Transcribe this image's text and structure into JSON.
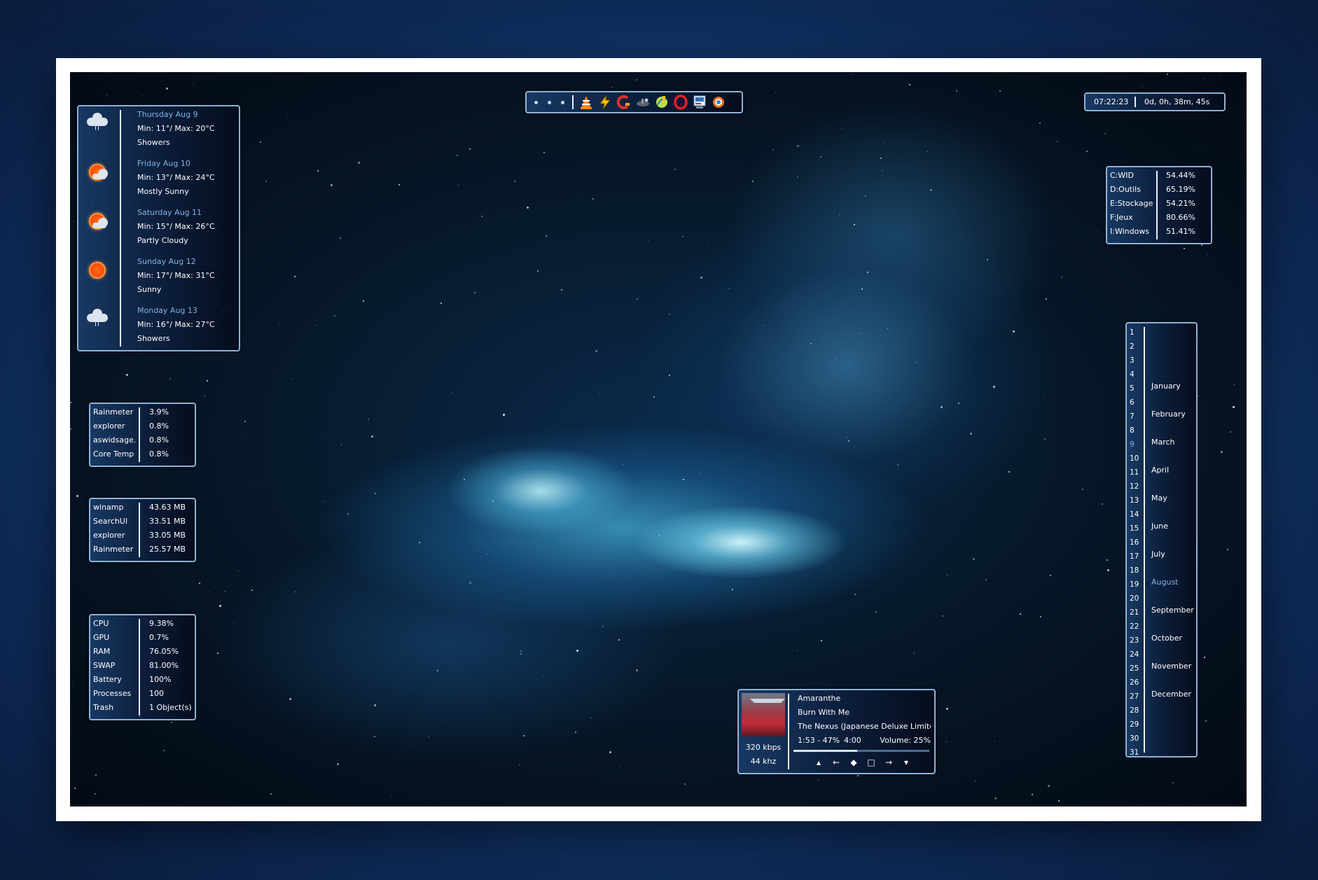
{
  "clock": {
    "time": "07:22:23",
    "uptime": "0d, 0h, 38m, 45s"
  },
  "weather": [
    {
      "day": "Thursday Aug 9",
      "temps": "Min: 11°/ Max: 20°C",
      "cond": "Showers",
      "icon": "showers-icon"
    },
    {
      "day": "Friday Aug 10",
      "temps": "Min: 13°/ Max: 24°C",
      "cond": "Mostly Sunny",
      "icon": "mostly-sunny-icon"
    },
    {
      "day": "Saturday Aug 11",
      "temps": "Min: 15°/ Max: 26°C",
      "cond": "Partly Cloudy",
      "icon": "partly-cloudy-icon"
    },
    {
      "day": "Sunday Aug 12",
      "temps": "Min: 17°/ Max: 31°C",
      "cond": "Sunny",
      "icon": "sunny-icon"
    },
    {
      "day": "Monday Aug 13",
      "temps": "Min: 16°/ Max: 27°C",
      "cond": "Showers",
      "icon": "showers-icon"
    }
  ],
  "cpu_procs": [
    {
      "name": "Rainmeter",
      "value": "3.9%"
    },
    {
      "name": "explorer",
      "value": "0.8%"
    },
    {
      "name": "aswidsage...",
      "value": "0.8%"
    },
    {
      "name": "Core Temp",
      "value": "0.8%"
    }
  ],
  "mem_procs": [
    {
      "name": "winamp",
      "value": "43.63 MB"
    },
    {
      "name": "SearchUI",
      "value": "33.51 MB"
    },
    {
      "name": "explorer",
      "value": "33.05 MB"
    },
    {
      "name": "Rainmeter",
      "value": "25.57 MB"
    }
  ],
  "system": [
    {
      "name": "CPU",
      "value": "9.38%"
    },
    {
      "name": "GPU",
      "value": "0.7%"
    },
    {
      "name": "RAM",
      "value": "76.05%"
    },
    {
      "name": "SWAP",
      "value": "81.00%"
    },
    {
      "name": "Battery",
      "value": "100%"
    },
    {
      "name": "Processes",
      "value": "100"
    },
    {
      "name": "Trash",
      "value": "1 Object(s)"
    }
  ],
  "drives": [
    {
      "name": "C:WID",
      "value": "54.44%"
    },
    {
      "name": "D:Outils",
      "value": "65.19%"
    },
    {
      "name": "E:Stockage",
      "value": "54.21%"
    },
    {
      "name": "F:Jeux",
      "value": "80.66%"
    },
    {
      "name": "I:Windows",
      "value": "51.41%"
    }
  ],
  "calendar": {
    "days": [
      "1",
      "2",
      "3",
      "4",
      "5",
      "6",
      "7",
      "8",
      "9",
      "10",
      "11",
      "12",
      "13",
      "14",
      "15",
      "16",
      "17",
      "18",
      "19",
      "20",
      "21",
      "22",
      "23",
      "24",
      "25",
      "26",
      "27",
      "28",
      "29",
      "30",
      "31"
    ],
    "today": "9",
    "months": [
      "January",
      "February",
      "March",
      "April",
      "May",
      "June",
      "July",
      "August",
      "September",
      "October",
      "November",
      "December"
    ],
    "current_month": "August"
  },
  "player": {
    "artist": "Amaranthe",
    "title": "Burn With Me",
    "album": "The Nexus (Japanese Deluxe Limited...",
    "position": "1:53 - 47%",
    "length": "4:00",
    "volume": "Volume: 25%",
    "bitrate": "320 kbps",
    "samplerate": "44 khz",
    "progress": 0.47
  },
  "dock_icons": [
    "vlc-icon",
    "winamp-icon",
    "ccleaner-icon",
    "steam-icon",
    "mirc-icon",
    "opera-icon",
    "monitor-icon",
    "settings-icon"
  ],
  "colors": {
    "accent": "#7fb4e6",
    "border": "#8db2d6"
  }
}
